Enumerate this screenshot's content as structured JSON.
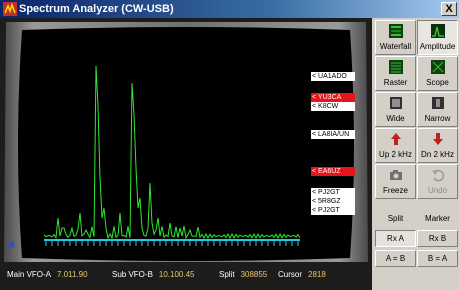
{
  "window": {
    "title": "Spectrum Analyzer (CW-USB)",
    "close_glyph": "X"
  },
  "display": {
    "trace_color": "#2ee82e",
    "marker_color": "#22c8e0",
    "spectrum_peaks_description_ignored": null
  },
  "callsigns": [
    {
      "text": "< UA1ADO",
      "highlight": false
    },
    {
      "text": "< YU3CA",
      "highlight": true
    },
    {
      "text": "< K8CW",
      "highlight": false
    },
    {
      "text": "< LA8IA/UN",
      "highlight": false
    },
    {
      "text": "< EA6UZ",
      "highlight": true
    },
    {
      "text": "< PJ2GT",
      "highlight": false
    },
    {
      "text": "< 5R8GZ",
      "highlight": false
    },
    {
      "text": "< PJ2GT",
      "highlight": false
    }
  ],
  "status": {
    "main_vfo_label": "Main VFO-A",
    "main_vfo_value": "7.011.90",
    "sub_vfo_label": "Sub VFO-B",
    "sub_vfo_value": "10.100.45",
    "split_label": "Split",
    "split_value": "308855",
    "cursor_label": "Cursor",
    "cursor_value": "2818"
  },
  "toolbar": {
    "waterfall": "Waterfall",
    "amplitude": "Amplitude",
    "raster": "Raster",
    "scope": "Scope",
    "wide": "Wide",
    "narrow": "Narrow",
    "up": "Up 2 kHz",
    "down": "Dn 2 kHz",
    "freeze": "Freeze",
    "undo": "Undo",
    "split": "Split",
    "marker": "Marker",
    "rx_a": "Rx A",
    "rx_b": "Rx B",
    "a_eq_b": "A = B",
    "b_eq_a": "B = A"
  }
}
